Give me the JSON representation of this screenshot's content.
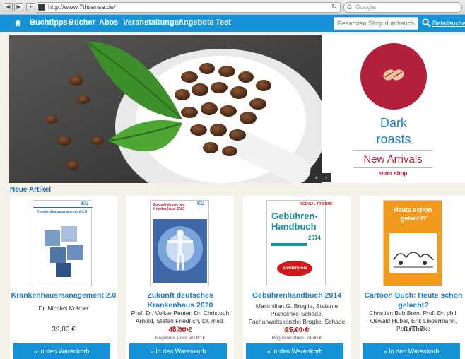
{
  "browser": {
    "back_glyph": "◀",
    "forward_glyph": "▶",
    "add_glyph": "+",
    "url": "http://www.7thsense.de/",
    "reload_glyph": "↻",
    "search_engine_glyph": "G",
    "search_placeholder": "Google"
  },
  "nav": {
    "items": [
      "Buchtipps",
      "Bücher",
      "Abos",
      "Veranstaltungen",
      "Angebote",
      "Test"
    ],
    "search_placeholder": "Gesamten Shop durchsuchen...",
    "detail_search": "Detailsuche",
    "home_icon": "home-icon",
    "search_icon": "search-icon"
  },
  "hero": {
    "title_line1": "Dark",
    "title_line2": "roasts",
    "subtitle": "New Arrivals",
    "cta": "enter shop",
    "prev_glyph": "‹",
    "next_glyph": "›",
    "accent": "#b3203c",
    "title_color": "#1f7fc4"
  },
  "section_title": "Neue Artikel",
  "products": [
    {
      "title": "Krankenhausmanagement 2.0",
      "authors": "Dr. Nicolas Krämer",
      "price": "39,80 €",
      "regular": "",
      "cart": "» In den Warenkorb",
      "cover_text": "Krankenhausmanagement 2.0",
      "cover_badge": "KU"
    },
    {
      "title": "Zukunft deutsches Krankenhaus 2020",
      "authors": "Prof. Dr. Volker Penter, Dr. Christoph Arnold, Stefan Friedrich, Dr. med. Sören",
      "price": "40,00 €",
      "regular": "Regulärer Preis: 49,80 €",
      "cart": "» In den Warenkorb",
      "cover_text": "Zukunft deutsches Krankenhaus 2020",
      "cover_badge": "KU"
    },
    {
      "title": "Gebührenhandbuch 2014",
      "authors": "Maximilian G. Broglie, Stefanie Pranschke-Schade, Fachanwaltskanzlei Broglie, Schade & Partner",
      "price": "25,00 €",
      "regular": "Regulärer Preis: 74,00 €",
      "cart": "» In den Warenkorb",
      "cover_text_1": "Gebühren-",
      "cover_text_2": "Handbuch",
      "cover_year": "2014",
      "cover_special": "Sonderpreis",
      "cover_badge": "MEDICAL TRIBUNE"
    },
    {
      "title": "Cartoon Buch: Heute schon gelacht?",
      "authors": "Christian Bob Born, Prof. Dr. phil. Oswald Huber, Erik Liebermann, Peter Thulke",
      "price": "8,60 €",
      "regular": "",
      "cart": "» In den Warenkorb",
      "cover_text_1": "Heute schon",
      "cover_text_2": "gelacht?"
    }
  ]
}
